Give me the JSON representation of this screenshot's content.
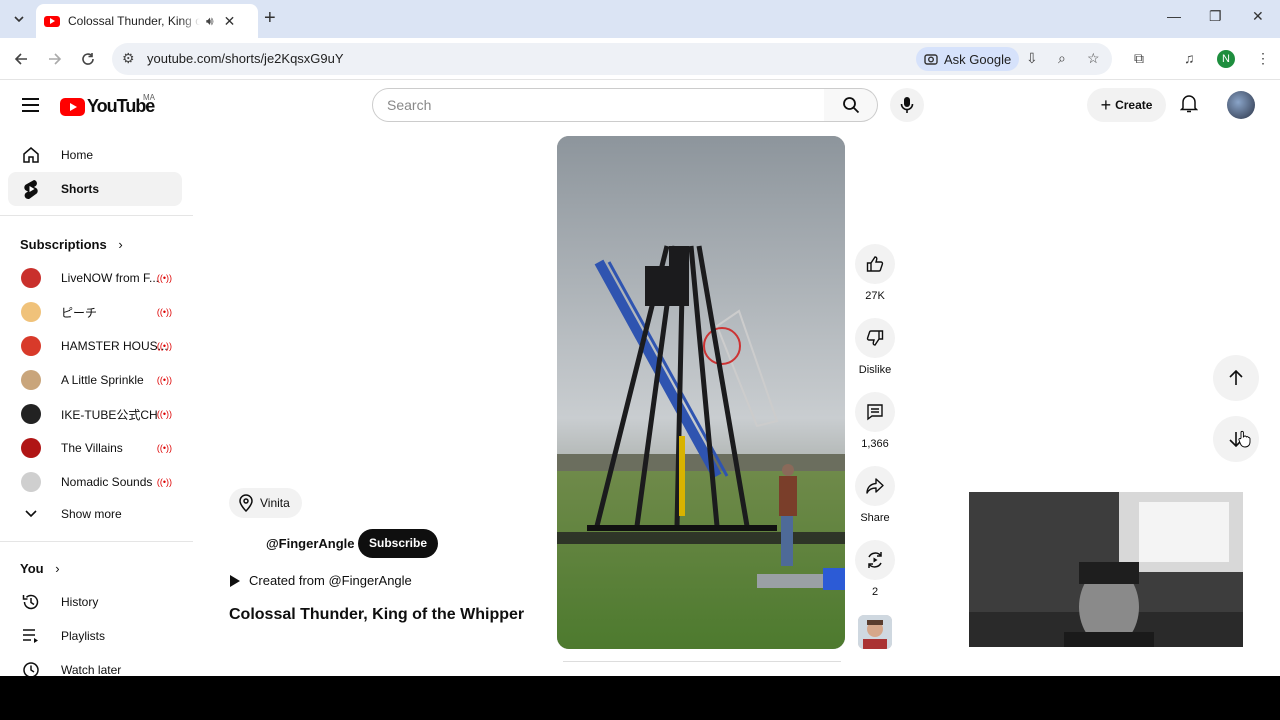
{
  "browser": {
    "tab_title": "Colossal Thunder, King of the Whipper",
    "url": "youtube.com/shorts/je2KqsxG9uY",
    "ask_google": "Ask Google",
    "profile_initial": "N",
    "icons": [
      "tab-search-icon",
      "speaker-icon",
      "close-icon",
      "new-tab-icon",
      "minimize-icon",
      "restore-icon",
      "window-close-icon",
      "back-icon",
      "forward-icon",
      "reload-icon",
      "site-info-icon",
      "install-icon",
      "zoom-icon",
      "star-icon",
      "extensions-icon",
      "media-icon",
      "menu-icon"
    ]
  },
  "youtube": {
    "logo_text": "YouTube",
    "country_code": "MA",
    "search_placeholder": "Search",
    "create_label": "Create"
  },
  "sidebar": {
    "home": "Home",
    "shorts": "Shorts",
    "subscriptions_header": "Subscriptions",
    "subscriptions": [
      {
        "name": "LiveNOW from F...",
        "live": true,
        "color": "#c9302c"
      },
      {
        "name": "ピーチ",
        "live": true,
        "color": "#f0c27a"
      },
      {
        "name": "HAMSTER HOUS...",
        "live": true,
        "color": "#d83a2a"
      },
      {
        "name": "A Little Sprinkle",
        "live": true,
        "color": "#c9a57b"
      },
      {
        "name": "IKE-TUBE公式CH",
        "live": true,
        "color": "#222222"
      },
      {
        "name": "The Villains",
        "live": true,
        "color": "#b01515"
      },
      {
        "name": "Nomadic Sounds",
        "live": true,
        "color": "#cfcfcf"
      }
    ],
    "show_more": "Show more",
    "you_header": "You",
    "history": "History",
    "playlists": "Playlists",
    "watch_later": "Watch later"
  },
  "short": {
    "location": "Vinita",
    "channel": "@FingerAngle",
    "subscribe": "Subscribe",
    "created_from": "Created from @FingerAngle",
    "title": "Colossal Thunder, King of the Whipper",
    "likes": "27K",
    "dislike": "Dislike",
    "comments": "1,366",
    "share": "Share",
    "remix": "2"
  }
}
